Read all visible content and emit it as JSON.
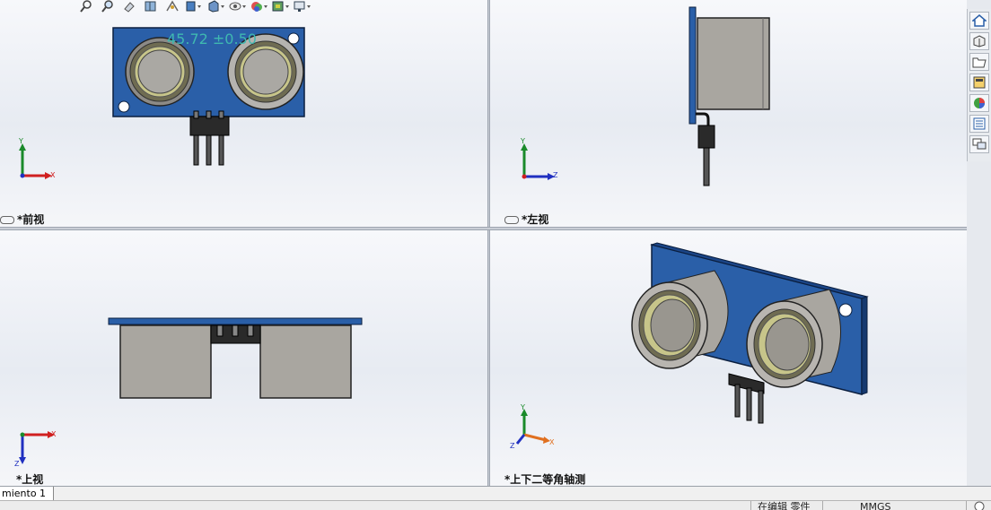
{
  "toolbar": {
    "icons": [
      "zoom-to-fit-icon",
      "zoom-area-icon",
      "previous-view-icon",
      "section-view-icon",
      "dynamic-annotation-icon",
      "view-orientation-icon",
      "display-style-icon",
      "hide-show-icon",
      "edit-appearance-icon",
      "apply-scene-icon",
      "view-settings-icon"
    ]
  },
  "viewports": {
    "front": {
      "label": "*前视",
      "dimension": "45.72 ±0.50",
      "axis_v": "Y",
      "axis_h": "X"
    },
    "left": {
      "label": "*左视",
      "axis_v": "Y",
      "axis_h": "Z"
    },
    "top": {
      "label": "*上视",
      "axis_v": "Z",
      "axis_h": "X"
    },
    "iso": {
      "label": "*上下二等角轴测",
      "axis_v": "Y",
      "axis_h": "X",
      "axis_d": "Z"
    }
  },
  "task_pane": {
    "icons": [
      "home-icon",
      "parts-library-icon",
      "file-explorer-icon",
      "view-palette-icon",
      "appearances-icon",
      "custom-properties-icon",
      "forum-icon"
    ]
  },
  "tabs": [
    {
      "label": "miento 1"
    }
  ],
  "status": {
    "edit_mode": "在编辑 零件",
    "units": "MMGS",
    "colors": {
      "board": "#2a5fa8",
      "cylinder": "#a9a6a0",
      "accent": "#3fb8b0"
    }
  }
}
